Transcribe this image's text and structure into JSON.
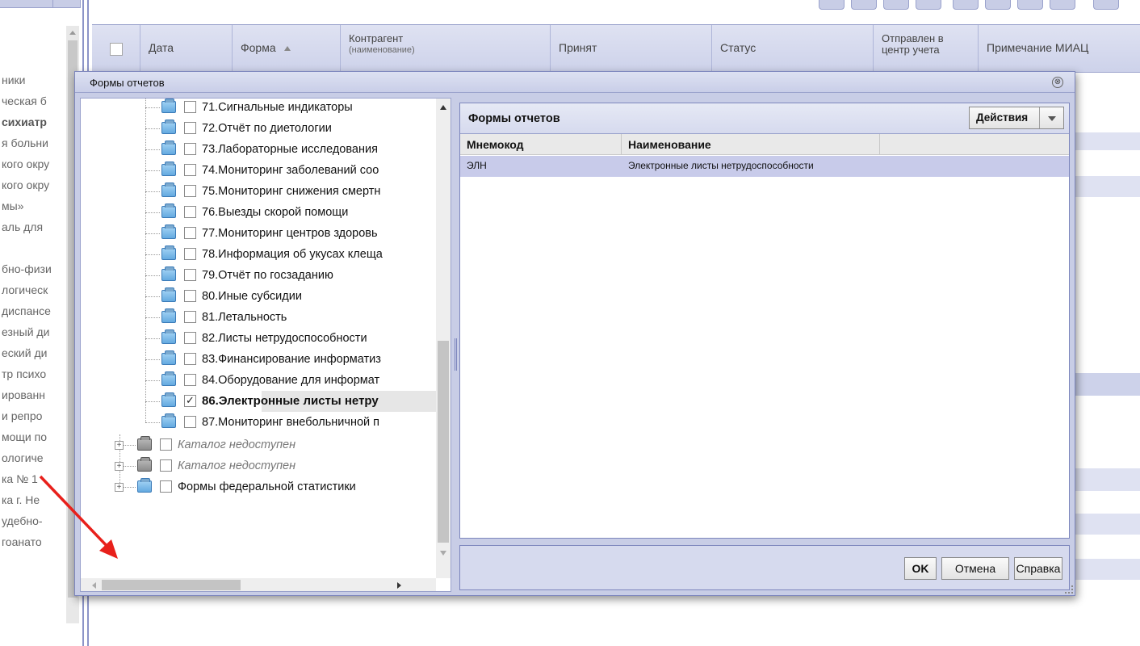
{
  "background": {
    "left_list": [
      "ники",
      "ческая б",
      "сихиатр",
      "я больни",
      "кого окру",
      "кого окру",
      "мы»",
      "аль для",
      "",
      "бно-физи",
      "логическ",
      "диспансе",
      "езный ди",
      "еский ди",
      "тр психо",
      "ированн",
      "и репро",
      "мощи по",
      "ологиче",
      "ка № 1",
      "ка г. Не",
      "удебно-",
      "гоанато"
    ],
    "columns": {
      "date": "Дата",
      "form": "Форма",
      "counterparty": "Контрагент",
      "counterparty_sub": "(наименование)",
      "accepted": "Принят",
      "status": "Статус",
      "sent_line1": "Отправлен в",
      "sent_line2": "центр учета",
      "note": "Примечание МИАЦ"
    }
  },
  "dialog": {
    "title": "Формы отчетов",
    "close_glyph": "⊗",
    "tree": {
      "items": [
        {
          "label": "71.Сигнальные индикаторы",
          "checked": false
        },
        {
          "label": "72.Отчёт по диетологии",
          "checked": false
        },
        {
          "label": "73.Лабораторные исследования",
          "checked": false
        },
        {
          "label": "74.Мониторинг заболеваний соо",
          "checked": false
        },
        {
          "label": "75.Мониторинг снижения смертн",
          "checked": false
        },
        {
          "label": "76.Выезды скорой помощи",
          "checked": false
        },
        {
          "label": "77.Мониторинг центров здоровь",
          "checked": false
        },
        {
          "label": "78.Информация об укусах клеща",
          "checked": false
        },
        {
          "label": "79.Отчёт по госзаданию",
          "checked": false
        },
        {
          "label": "80.Иные субсидии",
          "checked": false
        },
        {
          "label": "81.Летальность",
          "checked": false
        },
        {
          "label": "82.Листы нетрудоспособности",
          "checked": false
        },
        {
          "label": "83.Финансирование информатиз",
          "checked": false
        },
        {
          "label": "84.Оборудование для информат",
          "checked": false
        },
        {
          "label": "86.Электронные листы нетру",
          "checked": true
        },
        {
          "label": "87.Мониторинг внебольничной п",
          "checked": false
        }
      ],
      "roots": [
        {
          "label": "Каталог недоступен",
          "muted": true
        },
        {
          "label": "Каталог недоступен",
          "muted": true
        },
        {
          "label": "Формы федеральной статистики",
          "muted": false
        }
      ],
      "expander_glyph": "+"
    },
    "panel": {
      "title": "Формы отчетов",
      "actions_label": "Действия",
      "columns": [
        "Мнемокод",
        "Наименование"
      ],
      "rows": [
        {
          "code": "ЭЛН",
          "name": "Электронные листы нетрудоспособности"
        }
      ]
    },
    "buttons": {
      "ok": "OK",
      "cancel": "Отмена",
      "help": "Справка"
    }
  },
  "colors": {
    "accent": "#c8cde6",
    "selected_row": "#c8cbea",
    "annotation": "#e8201b"
  }
}
